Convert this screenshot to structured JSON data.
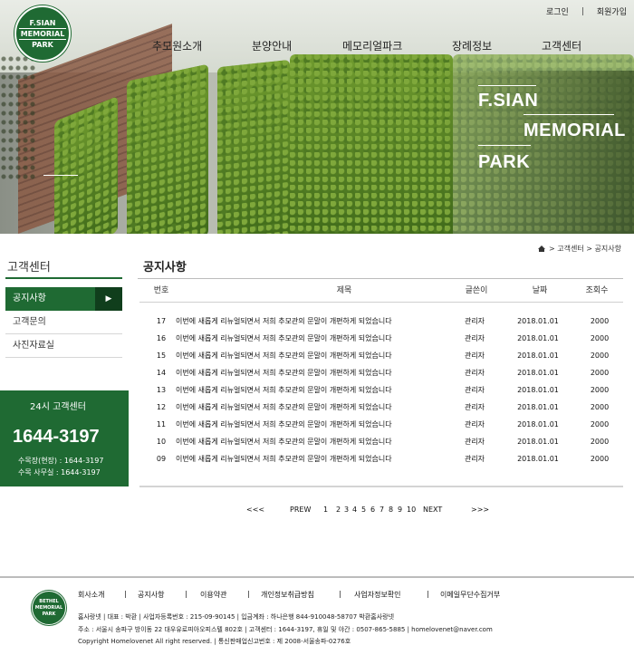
{
  "top_links": {
    "login": "로그인",
    "separator": "|",
    "join": "회원가입"
  },
  "logo": {
    "line1": "F.SIAN",
    "line2": "MEMORIAL",
    "line3": "PARK"
  },
  "gnb": [
    "추모원소개",
    "분양안내",
    "메모리얼파크",
    "장례정보",
    "고객센터"
  ],
  "hero": {
    "line1": "F.SIAN",
    "line2": "MEMORIAL",
    "line3": "PARK"
  },
  "sidebar": {
    "title": "고객센터",
    "items": [
      {
        "label": "공지사항",
        "active": true,
        "arrow": "▶"
      },
      {
        "label": "고객문의",
        "active": false
      },
      {
        "label": "사진자료실",
        "active": false
      }
    ]
  },
  "callcenter": {
    "title": "24시 고객센터",
    "number": "1644-3197",
    "line1": "수목장(현장) : 1644-3197",
    "line2": "수목 사무실 : 1644-3197"
  },
  "breadcrumb": {
    "home": "홈",
    "sep1": ">",
    "level1": "고객센터",
    "sep2": ">",
    "level2": "공지사항"
  },
  "page_title": "공지사항",
  "table": {
    "headers": {
      "no": "번호",
      "title": "제목",
      "writer": "글쓴이",
      "date": "날짜",
      "views": "조회수"
    },
    "rows": [
      {
        "no": "17",
        "title": "이번에 새롭게 리뉴얼되면서 저희 추모관의 문말이 개편하게 되었습니다",
        "writer": "관리자",
        "date": "2018.01.01",
        "views": "2000"
      },
      {
        "no": "16",
        "title": "이번에 새롭게 리뉴얼되면서 저희 추모관의 문말이 개편하게 되었습니다",
        "writer": "관리자",
        "date": "2018.01.01",
        "views": "2000"
      },
      {
        "no": "15",
        "title": "이번에 새롭게 리뉴얼되면서 저희 추모관의 문말이 개편하게 되었습니다",
        "writer": "관리자",
        "date": "2018.01.01",
        "views": "2000"
      },
      {
        "no": "14",
        "title": "이번에 새롭게 리뉴얼되면서 저희 추모관의 문말이 개편하게 되었습니다",
        "writer": "관리자",
        "date": "2018.01.01",
        "views": "2000"
      },
      {
        "no": "13",
        "title": "이번에 새롭게 리뉴얼되면서 저희 추모관의 문말이 개편하게 되었습니다",
        "writer": "관리자",
        "date": "2018.01.01",
        "views": "2000"
      },
      {
        "no": "12",
        "title": "이번에 새롭게 리뉴얼되면서 저희 추모관의 문말이 개편하게 되었습니다",
        "writer": "관리자",
        "date": "2018.01.01",
        "views": "2000"
      },
      {
        "no": "11",
        "title": "이번에 새롭게 리뉴얼되면서 저희 추모관의 문말이 개편하게 되었습니다",
        "writer": "관리자",
        "date": "2018.01.01",
        "views": "2000"
      },
      {
        "no": "10",
        "title": "이번에 새롭게 리뉴얼되면서 저희 추모관의 문말이 개편하게 되었습니다",
        "writer": "관리자",
        "date": "2018.01.01",
        "views": "2000"
      },
      {
        "no": "09",
        "title": "이번에 새롭게 리뉴얼되면서 저희 추모관의 문말이 개편하게 되었습니다",
        "writer": "관리자",
        "date": "2018.01.01",
        "views": "2000"
      }
    ]
  },
  "pagination": {
    "first": "<<<",
    "prev": "PREW",
    "pages": [
      "1",
      "2",
      "3",
      "4",
      "5",
      "6",
      "7",
      "8",
      "9",
      "10"
    ],
    "next": "NEXT",
    "last": ">>>"
  },
  "footer": {
    "logo": {
      "line1": "BETHEL",
      "line2": "MEMORIAL",
      "line3": "PARK"
    },
    "links": [
      "회사소개",
      "공지사항",
      "이용약관",
      "개인정보취급방침",
      "사업자정보확인",
      "이메일무단수집거부"
    ],
    "link_sep": "|",
    "info1": "홈사랑넷  |  대표 : 박환  |  사업자등록번호 : 215-09-90145  |  입금계좌 : 하나은행 844-910048-58707 박환홈사랑넷",
    "info2": "주소 : 서울시 송파구 방이동 22 대우유로피아오피스텔 802호  |  고객센터 : 1644-3197, 휴일 및 야간 : 0507-865-5885  |  homelovenet@naver.com",
    "info3": "Copyright Homelovenet All right reserved.  |  통신판매업신고번호 : 제 2008-서울송파-0276호"
  },
  "colors": {
    "brand_green": "#1f6a33",
    "dark_green": "#103e1c"
  }
}
